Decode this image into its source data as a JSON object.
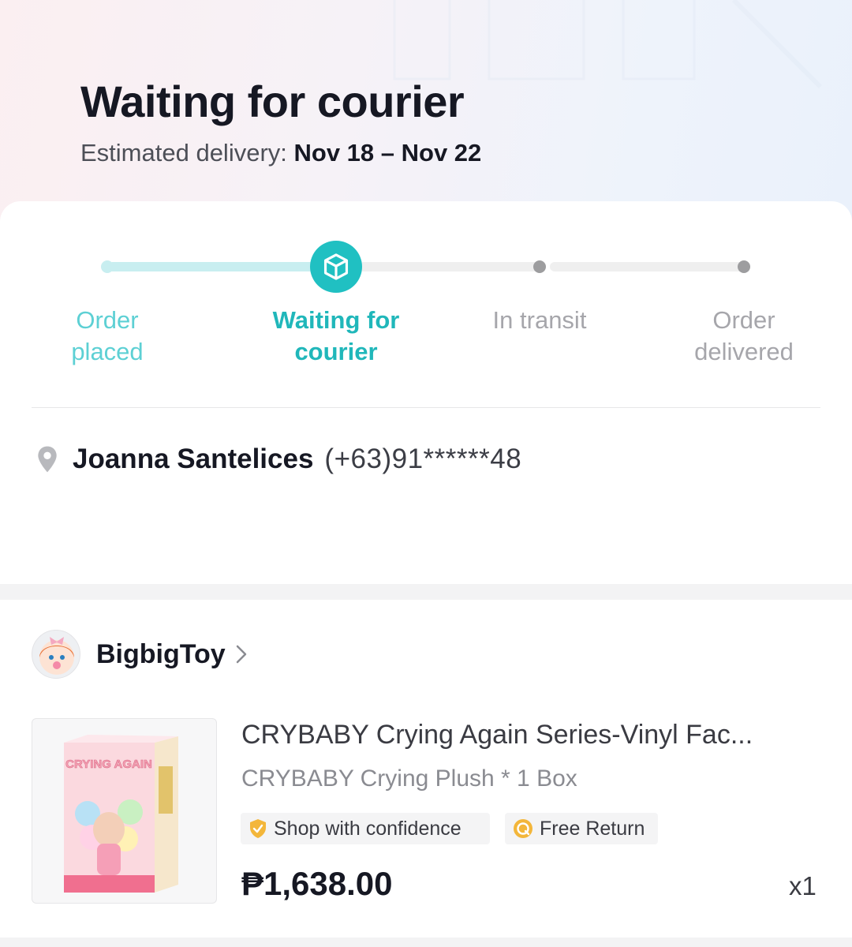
{
  "header": {
    "status_title": "Waiting for courier",
    "eta_label": "Estimated delivery: ",
    "eta_value": "Nov 18 – Nov 22"
  },
  "progress": {
    "current_step": 2,
    "accent_color": "#20c0c2",
    "steps": [
      {
        "label_line1": "Order",
        "label_line2": "placed"
      },
      {
        "label_line1": "Waiting for",
        "label_line2": "courier"
      },
      {
        "label_line1": "In transit",
        "label_line2": ""
      },
      {
        "label_line1": "Order",
        "label_line2": "delivered"
      }
    ]
  },
  "address": {
    "name": "Joanna Santelices",
    "phone": "(+63)91******48"
  },
  "shop": {
    "name": "BigbigToy"
  },
  "product": {
    "title": "CRYBABY Crying Again Series-Vinyl Fac...",
    "variant": "CRYBABY Crying Plush * 1 Box",
    "badges": [
      "Shop with confidence",
      "Free Return"
    ],
    "price": "₱1,638.00",
    "quantity": "x1",
    "thumb_text": "CRYING AGAIN"
  }
}
